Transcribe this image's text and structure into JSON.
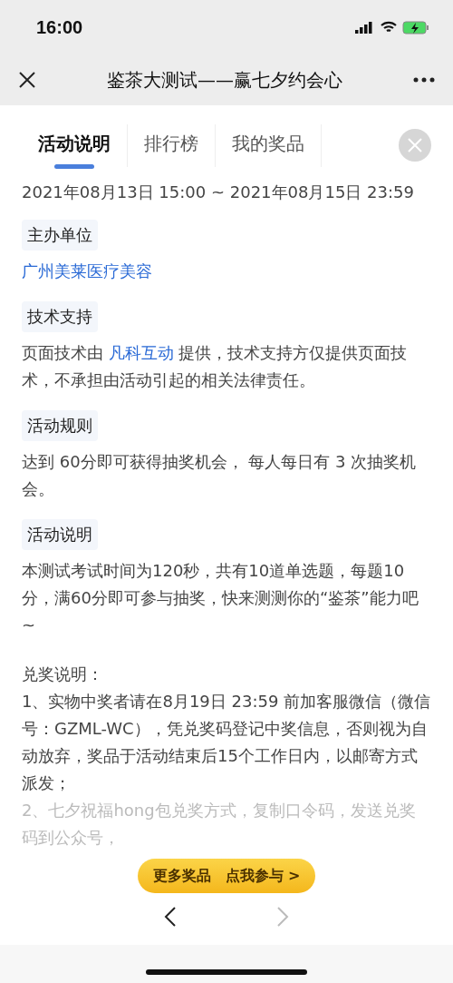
{
  "status_bar": {
    "time": "16:00"
  },
  "nav": {
    "title": "鉴茶大测试——赢七夕约会心"
  },
  "tabs": [
    {
      "label": "活动说明",
      "selected": true
    },
    {
      "label": "排行榜",
      "selected": false
    },
    {
      "label": "我的奖品",
      "selected": false
    }
  ],
  "date_range": "2021年08月13日 15:00 ~ 2021年08月15日 23:59",
  "sections": [
    {
      "header": "主办单位",
      "body": [
        {
          "text": "广州美莱医疗美容",
          "link": true
        }
      ]
    },
    {
      "header": "技术支持",
      "body": [
        {
          "text": "页面技术由 ",
          "link": false
        },
        {
          "text": "凡科互动",
          "link": true
        },
        {
          "text": " 提供，技术支持方仅提供页面技术，不承担由活动引起的相关法律责任。",
          "link": false
        }
      ]
    },
    {
      "header": "活动规则",
      "body": [
        {
          "text": "达到 60分即可获得抽奖机会， 每人每日有 3 次抽奖机会。",
          "link": false
        }
      ]
    },
    {
      "header": "活动说明",
      "body": [
        {
          "text": "本测试考试时间为120秒，共有10道单选题，每题10分，满60分即可参与抽奖，快来测测你的“鉴茶”能力吧~",
          "link": false
        }
      ]
    }
  ],
  "prize_info": {
    "title": "兑奖说明：",
    "items": [
      {
        "text": "1、实物中奖者请在8月19日 23:59 前加客服微信（微信号：GZML-WC），凭兑奖码登记中奖信息，否则视为自动放弃，奖品于活动结束后15个工作日内，以邮寄方式派发；",
        "kind": "plain"
      },
      {
        "text": "2、七夕祝福hong包兑奖方式，复制口令码，发送兑奖码到公众号，",
        "kind": "faded"
      }
    ]
  },
  "cta_button": "更多奖品　点我参与 >",
  "browser_nav": {
    "back_disabled": false,
    "forward_disabled": true
  }
}
